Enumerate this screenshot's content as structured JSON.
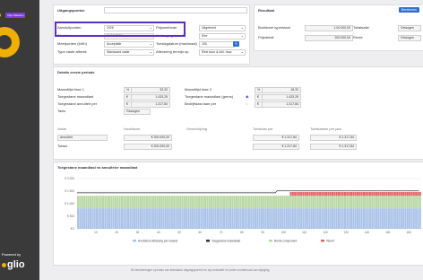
{
  "sidebar": {
    "badge": "Vrije Plaatsen",
    "powered": "Powered by",
    "logo": "glio"
  },
  "start": {
    "title": "Uitgangspunten",
    "fields": [
      {
        "label": "Aansluitpunten",
        "value": "2026"
      },
      {
        "label": "Startdatum",
        "value": "01/10/2026"
      },
      {
        "label": "Meetpunten (kWh)",
        "value": "Acceptatie"
      },
      {
        "label": "Type vaste aftreek",
        "value": "Standaard vaste"
      }
    ],
    "fields2": [
      {
        "label": "Prijsmethode",
        "value": "Uitgebreid"
      },
      {
        "label": "Verlenging duur 0",
        "value": "Ree"
      },
      {
        "label": "Toeslagdatum (maximaal)",
        "value": "150"
      },
      {
        "label": "Aflevering termijn op",
        "value": "Rest duur & inkl. duur"
      }
    ]
  },
  "result": {
    "title": "Resultaat",
    "button": "Berekenen",
    "rows": [
      {
        "label": "Bruikbare typetotaal",
        "value": "1.00.000,00"
      },
      {
        "label": "Prijsdetail",
        "value": "200.000,00"
      }
    ],
    "rows2": [
      {
        "label": "Totalisatie",
        "value": "Gewogen"
      },
      {
        "label": "Rente",
        "value": "Gewogen"
      }
    ]
  },
  "details": {
    "title": "Details eerste periode",
    "left": [
      {
        "label": "Maandlijst fase 1",
        "unit": "%",
        "value": "33,33"
      },
      {
        "label": "Toegestane maandlast",
        "unit": "€",
        "value": "1.433,25"
      },
      {
        "label": "Toegestane annuïteit per",
        "unit": "€",
        "value": "1.317,84"
      },
      {
        "label": "Taxis",
        "unit": "",
        "value": "Gewogen"
      }
    ],
    "right": [
      {
        "label": "Maandlijst fase 2",
        "unit": "%",
        "value": "18,33"
      },
      {
        "label": "Toegestane maandlast (grens)",
        "unit": "€",
        "value": "1.433,25"
      },
      {
        "label": "Bedrijfslast laan per",
        "unit": "€",
        "value": "1.317,84"
      }
    ],
    "table": {
      "headers": [
        "Vaste",
        "Hoofdsom",
        "Omschrijving",
        "Toetslast per",
        "Toetslasten per jaar"
      ],
      "rows": [
        {
          "name": "Annuïteit",
          "amount": "€ 200.000,00",
          "desc": "",
          "p1": "€ 1.317,84",
          "p2": "€ 1.317,84"
        },
        {
          "name": "Totaal",
          "amount": "€ 200.000,00",
          "desc": "",
          "p1": "€ 1.317,84",
          "p2": "€ 1.317,84"
        }
      ]
    }
  },
  "chart_section": {
    "title": "Toegestane maandlast vs annuïteire maandlast"
  },
  "chart_data": {
    "type": "bar",
    "ylim": [
      0,
      2000
    ],
    "yticks": [
      "€ 2.000",
      "€ 1.500",
      "€ 1.000",
      "€ 500",
      "€ 0"
    ],
    "xticks": [
      "10",
      "20",
      "30",
      "40",
      "50",
      "60",
      "70",
      "80",
      "90",
      "100",
      "110",
      "120",
      "130",
      "140",
      "150",
      "160"
    ],
    "n_bars": 165,
    "series": [
      {
        "name": "Hoofdsom aflossing per maand",
        "color": "#a9c2e8"
      },
      {
        "name": "Toegestane maandlast",
        "color": "#333333"
      },
      {
        "name": "Rente component",
        "color": "#b8d8a4"
      },
      {
        "name": "Tekort",
        "color": "#e06666"
      }
    ],
    "allowed": [
      {
        "from": 1,
        "to": 96,
        "value": 1433
      },
      {
        "from": 97,
        "to": 165,
        "value": 1520
      }
    ],
    "annuity": 1318,
    "deficit_from": 103
  },
  "footnote": "Dit berekeningen op basis van standaard uitgangspunten en zijn indicatief en onder voorbehoud van wijziging."
}
